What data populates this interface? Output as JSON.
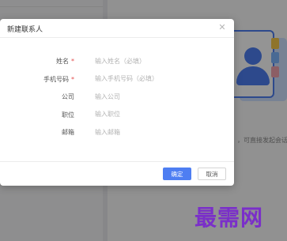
{
  "background": {
    "hint_text": "，可直接发起会话",
    "illustration_icon": "contact-card-icon"
  },
  "dialog": {
    "title": "新建联系人",
    "close_icon": "close-icon",
    "fields": [
      {
        "label": "姓名",
        "required": true,
        "placeholder": "输入姓名（必填）",
        "value": ""
      },
      {
        "label": "手机号码",
        "required": true,
        "placeholder": "输入手机号码（必填）",
        "value": ""
      },
      {
        "label": "公司",
        "required": false,
        "placeholder": "输入公司",
        "value": ""
      },
      {
        "label": "职位",
        "required": false,
        "placeholder": "输入职位",
        "value": ""
      },
      {
        "label": "邮箱",
        "required": false,
        "placeholder": "输入邮箱",
        "value": ""
      }
    ],
    "required_marker": "*",
    "confirm_label": "确定",
    "cancel_label": "取消"
  },
  "watermark": "最需网",
  "colors": {
    "accent": "#4e7ef2",
    "required": "#e34d4d",
    "watermark": "#7a2fc9"
  }
}
